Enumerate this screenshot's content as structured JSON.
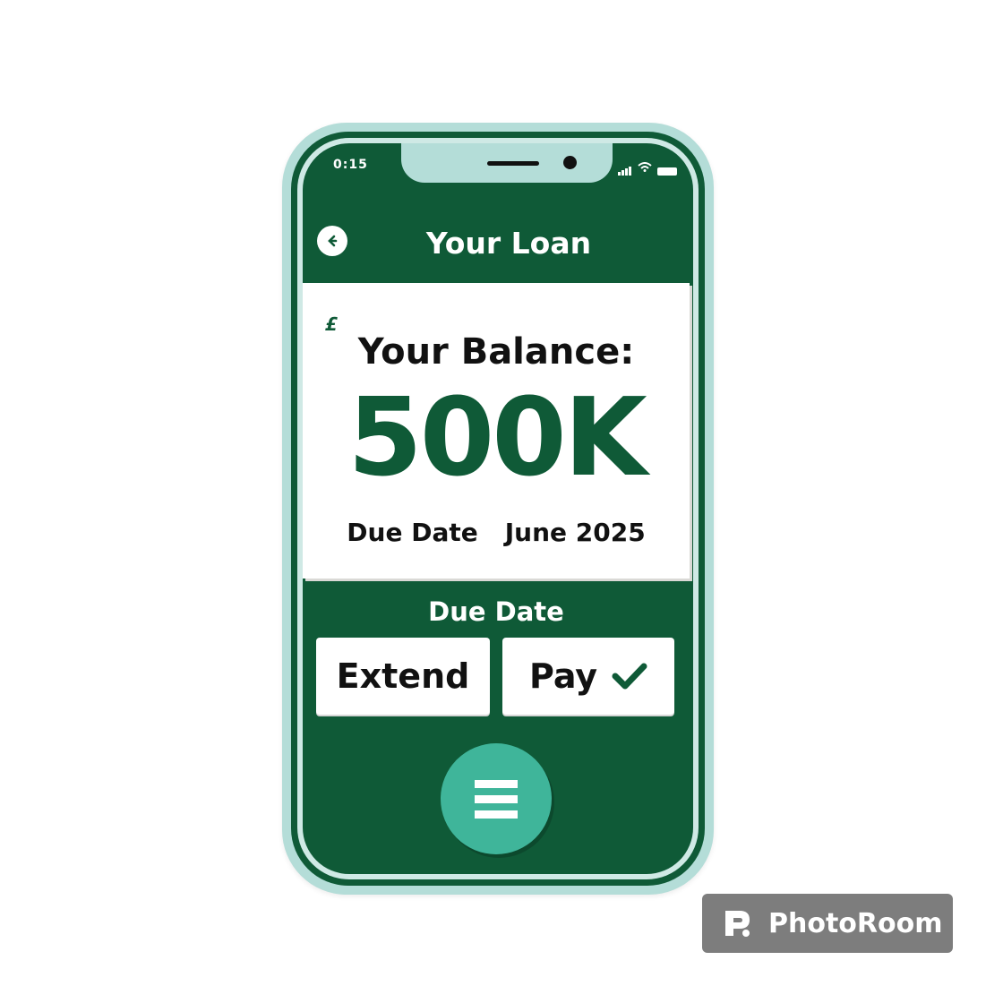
{
  "status_bar": {
    "time": "0:15"
  },
  "header": {
    "title": "Your Loan",
    "back_icon": "arrow-left-icon"
  },
  "balance_card": {
    "currency_symbol": "£",
    "label": "Your Balance:",
    "amount": "500K",
    "due_label": "Due Date",
    "due_value": "June 2025"
  },
  "due_section": {
    "heading": "Due Date"
  },
  "actions": {
    "extend_label": "Extend",
    "pay_label": "Pay",
    "pay_icon": "check-icon"
  },
  "menu": {
    "icon": "hamburger-menu-icon"
  },
  "watermark": {
    "text": "PhotoRoom"
  },
  "colors": {
    "primary": "#0f5a37",
    "accent": "#3fb59a",
    "frame": "#b4ddd8"
  }
}
